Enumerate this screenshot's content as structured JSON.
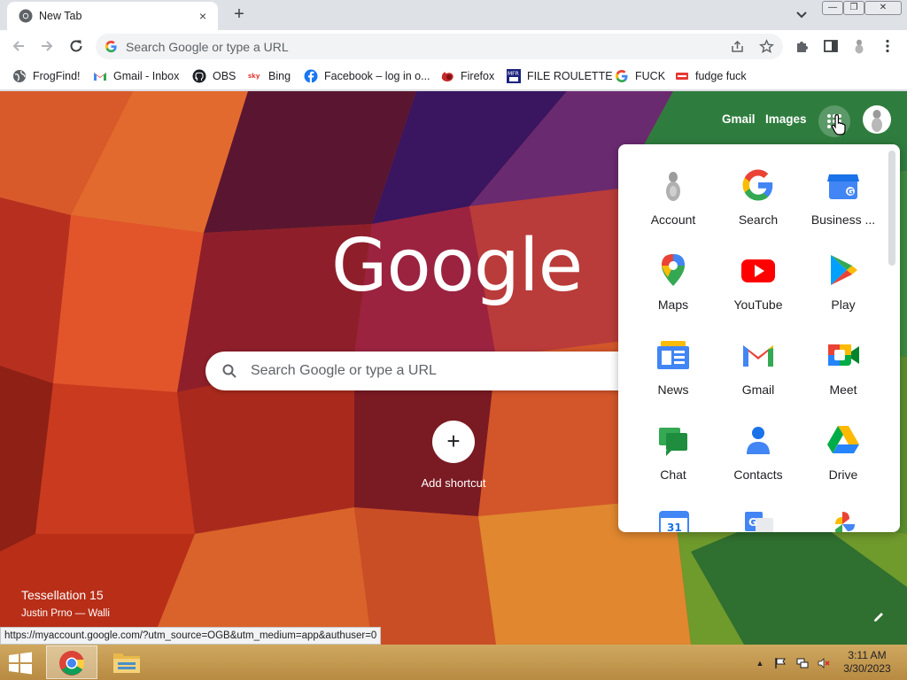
{
  "browser": {
    "tab": {
      "title": "New Tab",
      "favicon": "chrome-icon",
      "close": "×"
    },
    "new_tab": "+",
    "window_buttons": {
      "minimize": "—",
      "restore": "❐",
      "close": "✕"
    },
    "omnibox": {
      "placeholder": "Search Google or type a URL"
    },
    "bookmarks": [
      {
        "label": "FrogFind!",
        "icon": "globe-icon"
      },
      {
        "label": "Gmail - Inbox",
        "icon": "gmail-icon"
      },
      {
        "label": "OBS",
        "icon": "github-icon"
      },
      {
        "label": "Bing",
        "icon": "bing-icon"
      },
      {
        "label": "Facebook – log in o...",
        "icon": "facebook-icon"
      },
      {
        "label": "Firefox",
        "icon": "firefox-icon"
      },
      {
        "label": "FILE ROULETTE",
        "icon": "file-roulette-icon"
      },
      {
        "label": "FUCK",
        "icon": "google-icon"
      },
      {
        "label": "fudge fuck",
        "icon": "red-tag-icon"
      }
    ]
  },
  "newtab": {
    "gmail_link": "Gmail",
    "images_link": "Images",
    "logo": "Google",
    "search_placeholder": "Search Google or type a URL",
    "add_shortcut_icon": "+",
    "add_shortcut_label": "Add shortcut",
    "background_title": "Tessellation 15",
    "background_author": "Justin Prno — Walli"
  },
  "apps": [
    {
      "label": "Account",
      "icon": "account-avatar-icon"
    },
    {
      "label": "Search",
      "icon": "google-g-icon"
    },
    {
      "label": "Business ...",
      "icon": "business-profile-icon"
    },
    {
      "label": "Maps",
      "icon": "maps-pin-icon"
    },
    {
      "label": "YouTube",
      "icon": "youtube-icon"
    },
    {
      "label": "Play",
      "icon": "play-store-icon"
    },
    {
      "label": "News",
      "icon": "news-icon"
    },
    {
      "label": "Gmail",
      "icon": "gmail-icon"
    },
    {
      "label": "Meet",
      "icon": "meet-icon"
    },
    {
      "label": "Chat",
      "icon": "chat-icon"
    },
    {
      "label": "Contacts",
      "icon": "contacts-icon"
    },
    {
      "label": "Drive",
      "icon": "drive-icon"
    }
  ],
  "status_url": "https://myaccount.google.com/?utm_source=OGB&utm_medium=app&authuser=0",
  "taskbar": {
    "time": "3:11 AM",
    "date": "3/30/2023",
    "tray_arrow": "▲"
  }
}
